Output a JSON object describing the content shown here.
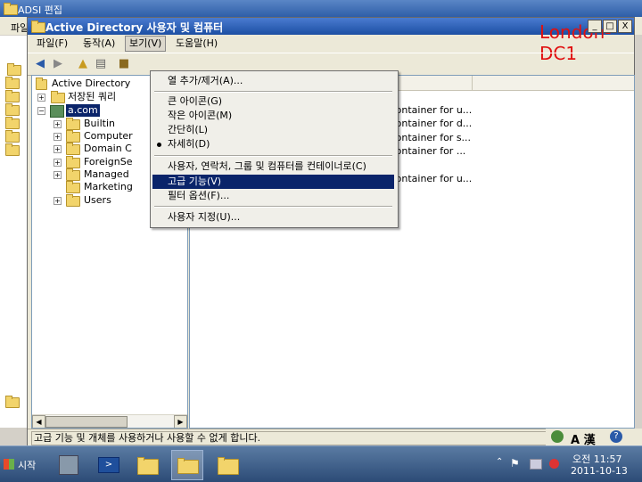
{
  "background_window": {
    "title": "ADSI 편집",
    "menu_partial": "파일"
  },
  "window": {
    "title": "Active Directory 사용자 및 컴퓨터",
    "server_label": "London-DC1",
    "controls": {
      "minimize": "_",
      "maximize": "□",
      "close": "X"
    }
  },
  "menubar": [
    {
      "label": "파일(F)"
    },
    {
      "label": "동작(A)"
    },
    {
      "label": "보기(V)"
    },
    {
      "label": "도움말(H)"
    }
  ],
  "tree": {
    "root": "Active Directory",
    "saved_queries": "저장된 쿼리",
    "domain": "a.com",
    "children": [
      "Builtin",
      "Computer",
      "Domain C",
      "ForeignSe",
      "Managed",
      "Marketing",
      "Users"
    ]
  },
  "list": {
    "column_headers": [
      "",
      "명"
    ],
    "rows": [
      "ault container for u...",
      "ault container for d...",
      "ault container for s...",
      "ault container for ...",
      "ault container for u..."
    ]
  },
  "view_menu": {
    "items": [
      {
        "label": "열 추가/제거(A)..."
      },
      {
        "label": "큰 아이콘(G)"
      },
      {
        "label": "작은 아이콘(M)"
      },
      {
        "label": "간단히(L)"
      },
      {
        "label": "자세히(D)",
        "checked": true
      },
      {
        "label": "사용자, 연락처, 그룹 및 컴퓨터를 컨테이너로(C)"
      },
      {
        "label": "고급 기능(V)",
        "highlighted": true
      },
      {
        "label": "필터 옵션(F)..."
      },
      {
        "label": "사용자 지정(U)..."
      }
    ]
  },
  "status_bar": {
    "text": "고급 기능 및 개체를 사용하거나 사용할 수 없게 합니다."
  },
  "language_bar": {
    "label": "A 漢"
  },
  "taskbar": {
    "start_label": "시작",
    "clock": {
      "time": "오전 11:57",
      "date": "2011-10-13"
    }
  },
  "colors": {
    "highlight": "#0a246a",
    "title_bar": "#1c4fa3",
    "server_label": "#e01010"
  }
}
